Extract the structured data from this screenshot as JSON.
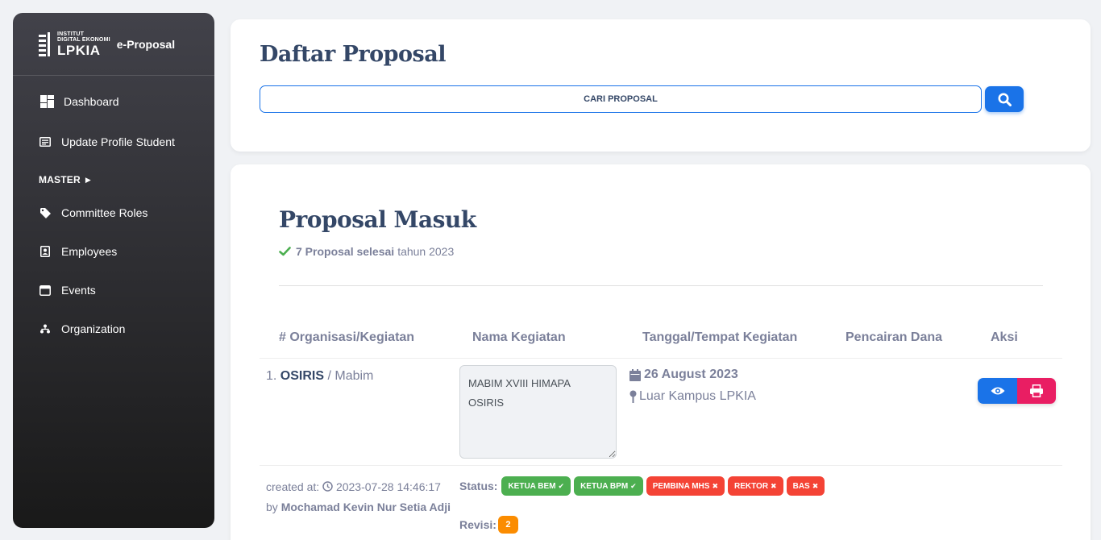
{
  "sidebar": {
    "logo": {
      "line1": "INSTITUT",
      "line2": "DIGITAL EKONOMI",
      "line3": "LPKIA"
    },
    "app_name": "e-Proposal",
    "items": [
      {
        "label": "Dashboard",
        "icon": "dashboard-icon"
      },
      {
        "label": "Update Profile Student",
        "icon": "profile-card-icon"
      }
    ],
    "section": "MASTER",
    "master_items": [
      {
        "label": "Committee Roles",
        "icon": "tag-icon"
      },
      {
        "label": "Employees",
        "icon": "badge-icon"
      },
      {
        "label": "Events",
        "icon": "calendar-icon"
      },
      {
        "label": "Organization",
        "icon": "organization-icon"
      }
    ]
  },
  "header": {
    "title": "Daftar Proposal",
    "search_placeholder": "CARI PROPOSAL"
  },
  "main": {
    "title": "Proposal Masuk",
    "summary_bold": "7 Proposal selesai",
    "summary_rest": "tahun 2023",
    "columns": [
      "# Organisasi/Kegiatan",
      "Nama Kegiatan",
      "Tanggal/Tempat Kegiatan",
      "Pencairan Dana",
      "Aksi"
    ],
    "rows": [
      {
        "number": "1.",
        "org": "OSIRIS",
        "sep": " / ",
        "kegiatan": "Mabim",
        "nama_kegiatan": "MABIM XVIII HIMAPA OSIRIS",
        "tanggal": "26 August 2023",
        "tempat": "Luar Kampus LPKIA",
        "created_label": "created at:",
        "created_at": "2023-07-28 14:46:17",
        "by_label": "by",
        "created_by": "Mochamad Kevin Nur Setia Adji",
        "status_label": "Status:",
        "statuses": [
          {
            "label": "KETUA BEM",
            "state": "approved",
            "mark": "✔"
          },
          {
            "label": "KETUA BPM",
            "state": "approved",
            "mark": "✔"
          },
          {
            "label": "PEMBINA MHS",
            "state": "rejected",
            "mark": "✖"
          },
          {
            "label": "REKTOR",
            "state": "rejected",
            "mark": "✖"
          },
          {
            "label": "BAS",
            "state": "rejected",
            "mark": "✖"
          }
        ],
        "revisi_label": "Revisi:",
        "revisi_count": "2"
      }
    ]
  },
  "colors": {
    "primary": "#1a73e8",
    "danger": "#e91e63",
    "success": "#4caf50",
    "error": "#f44335",
    "warning": "#fb8c00"
  }
}
